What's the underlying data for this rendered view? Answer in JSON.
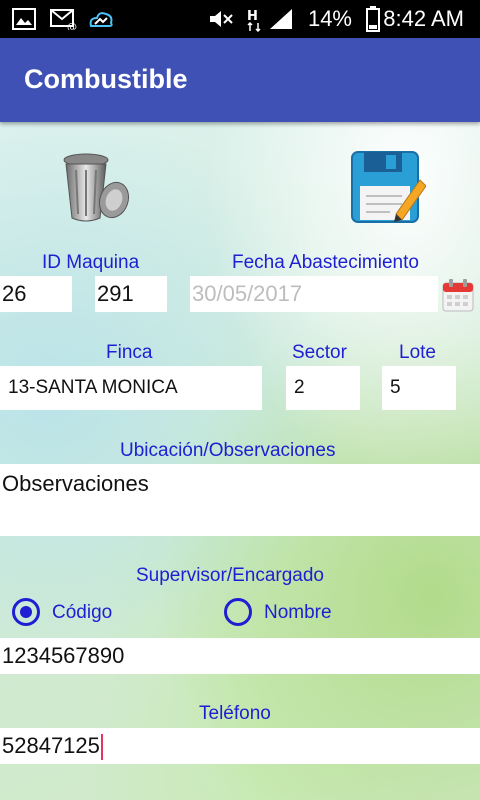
{
  "status_bar": {
    "battery_percent": "14%",
    "time": "8:42 AM",
    "icons": [
      "image-icon",
      "email-icon",
      "cloud-icon",
      "mute-icon",
      "signal-h-icon",
      "signal-icon",
      "battery-icon"
    ]
  },
  "app_bar": {
    "title": "Combustible"
  },
  "actions": {
    "delete_icon": "trash-can-icon",
    "save_icon": "floppy-save-icon"
  },
  "form": {
    "id_maquina": {
      "label": "ID Maquina",
      "value1": "26",
      "value2": "291"
    },
    "fecha": {
      "label": "Fecha Abastecimiento",
      "value": "30/05/2017",
      "icon": "calendar-icon"
    },
    "finca": {
      "label": "Finca",
      "value": "13-SANTA MONICA"
    },
    "sector": {
      "label": "Sector",
      "value": "2"
    },
    "lote": {
      "label": "Lote",
      "value": "5"
    },
    "ubicacion": {
      "label": "Ubicación/Observaciones",
      "value": "Observaciones"
    },
    "supervisor": {
      "label": "Supervisor/Encargado",
      "option_codigo": "Código",
      "option_nombre": "Nombre",
      "selected": "Código",
      "value": "1234567890"
    },
    "telefono": {
      "label": "Teléfono",
      "value": "52847125"
    }
  },
  "colors": {
    "accent": "#3f51b5",
    "label": "#1e1ed2",
    "cursor": "#e53368"
  }
}
